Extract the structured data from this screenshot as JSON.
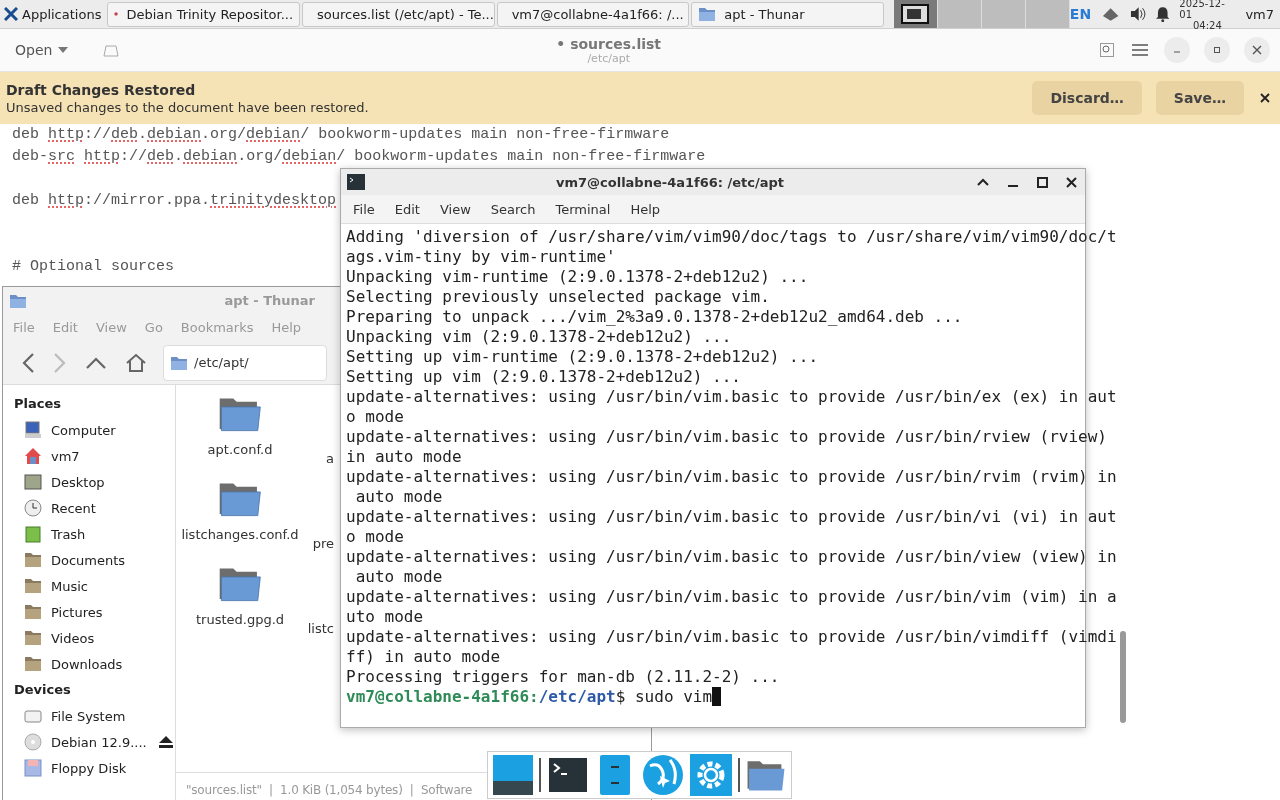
{
  "panel": {
    "apps_menu": "Applications",
    "tasks": [
      {
        "label": "Debian Trinity Repositor...",
        "kind": "browser"
      },
      {
        "label": "sources.list (/etc/apt) - Te...",
        "kind": "editor"
      },
      {
        "label": "vm7@collabne-4a1f66: /...",
        "kind": "terminal"
      },
      {
        "label": "apt - Thunar",
        "kind": "folder"
      }
    ],
    "workspaces": [
      {
        "selected": true
      },
      {
        "selected": false
      },
      {
        "selected": false
      },
      {
        "selected": false
      }
    ],
    "tray": {
      "language": "EN",
      "date": "2025-12-01",
      "time": "04:24",
      "user": "vm7"
    }
  },
  "editor": {
    "open_button": "Open",
    "title": "• sources.list",
    "subtitle": "/etc/apt",
    "infobar": {
      "title": "Draft Changes Restored",
      "message": "Unsaved changes to the document have been restored.",
      "buttons": [
        "Discard…",
        "Save…"
      ]
    },
    "lines": [
      {
        "kind": "code",
        "segments": [
          {
            "text": "deb ",
            "misspelled": false
          },
          {
            "text": "http",
            "misspelled": true
          },
          {
            "text": "://",
            "misspelled": false
          },
          {
            "text": "deb",
            "misspelled": true
          },
          {
            "text": ".",
            "misspelled": false
          },
          {
            "text": "debian",
            "misspelled": true
          },
          {
            "text": ".org/",
            "misspelled": false
          },
          {
            "text": "debian",
            "misspelled": true
          },
          {
            "text": "/ bookworm-updates main non-free-firmware",
            "misspelled": false
          }
        ]
      },
      {
        "kind": "code",
        "segments": [
          {
            "text": "deb-",
            "misspelled": false
          },
          {
            "text": "src",
            "misspelled": true
          },
          {
            "text": " http",
            "misspelled": true
          },
          {
            "text": "://",
            "misspelled": false
          },
          {
            "text": "deb",
            "misspelled": true
          },
          {
            "text": ".",
            "misspelled": false
          },
          {
            "text": "debian",
            "misspelled": true
          },
          {
            "text": ".org/",
            "misspelled": false
          },
          {
            "text": "debian",
            "misspelled": true
          },
          {
            "text": "/ bookworm-updates main non-free-firmware",
            "misspelled": false
          }
        ]
      },
      {
        "kind": "blank"
      },
      {
        "kind": "code",
        "segments": [
          {
            "text": "deb ",
            "misspelled": false
          },
          {
            "text": "http",
            "misspelled": true
          },
          {
            "text": "://mirror.ppa.",
            "misspelled": false
          },
          {
            "text": "trinitydesktop",
            "misspelled": true
          }
        ]
      },
      {
        "kind": "blank"
      },
      {
        "kind": "blank"
      },
      {
        "kind": "code",
        "segments": [
          {
            "text": "# Optional sources",
            "misspelled": false
          }
        ]
      }
    ]
  },
  "thunar": {
    "title": "apt - Thunar",
    "menu": [
      "File",
      "Edit",
      "View",
      "Go",
      "Bookmarks",
      "Help"
    ],
    "location": "/etc/apt/",
    "sections": [
      {
        "title": "Places",
        "items": [
          {
            "label": "Computer",
            "kind": "computer"
          },
          {
            "label": "vm7",
            "kind": "home"
          },
          {
            "label": "Desktop",
            "kind": "desktop"
          },
          {
            "label": "Recent",
            "kind": "recent"
          },
          {
            "label": "Trash",
            "kind": "trash"
          },
          {
            "label": "Documents",
            "kind": "folder"
          },
          {
            "label": "Music",
            "kind": "folder"
          },
          {
            "label": "Pictures",
            "kind": "folder"
          },
          {
            "label": "Videos",
            "kind": "folder"
          },
          {
            "label": "Downloads",
            "kind": "folder"
          }
        ]
      },
      {
        "title": "Devices",
        "items": [
          {
            "label": "File System",
            "kind": "drive"
          },
          {
            "label": "Debian 12.9....",
            "kind": "disc"
          },
          {
            "label": "Floppy Disk",
            "kind": "floppy"
          }
        ]
      }
    ],
    "folders": [
      {
        "label": "apt.conf.d",
        "column_2": "a"
      },
      {
        "label": "listchanges.conf.d",
        "column_2": "pre"
      },
      {
        "label": "trusted.gpg.d",
        "column_2": "listc"
      }
    ],
    "status": "\"sources.list\"  |  1.0 KiB (1,054 bytes)  |  Software"
  },
  "terminal": {
    "title": "vm7@collabne-4a1f66: /etc/apt",
    "menu": [
      "File",
      "Edit",
      "View",
      "Search",
      "Terminal",
      "Help"
    ],
    "rows": [
      "Adding 'diversion of /usr/share/vim/vim90/doc/tags to /usr/share/vim/vim90/doc/t",
      "ags.vim-tiny by vim-runtime'",
      "Unpacking vim-runtime (2:9.0.1378-2+deb12u2) ...",
      "Selecting previously unselected package vim.",
      "Preparing to unpack .../vim_2%3a9.0.1378-2+deb12u2_amd64.deb ...",
      "Unpacking vim (2:9.0.1378-2+deb12u2) ...",
      "Setting up vim-runtime (2:9.0.1378-2+deb12u2) ...",
      "Setting up vim (2:9.0.1378-2+deb12u2) ...",
      "update-alternatives: using /usr/bin/vim.basic to provide /usr/bin/ex (ex) in aut",
      "o mode",
      "update-alternatives: using /usr/bin/vim.basic to provide /usr/bin/rview (rview)",
      "in auto mode",
      "update-alternatives: using /usr/bin/vim.basic to provide /usr/bin/rvim (rvim) in",
      " auto mode",
      "update-alternatives: using /usr/bin/vim.basic to provide /usr/bin/vi (vi) in aut",
      "o mode",
      "update-alternatives: using /usr/bin/vim.basic to provide /usr/bin/view (view) in",
      " auto mode",
      "update-alternatives: using /usr/bin/vim.basic to provide /usr/bin/vim (vim) in a",
      "uto mode",
      "update-alternatives: using /usr/bin/vim.basic to provide /usr/bin/vimdiff (vimdi",
      "ff) in auto mode",
      "Processing triggers for man-db (2.11.2-2) ..."
    ],
    "prompt": {
      "user_host": "vm7@collabne-4a1f66:",
      "path": "/etc/apt",
      "command": "$ sudo vim"
    }
  },
  "dock": [
    {
      "kind": "show-desktop"
    },
    {
      "kind": "separator"
    },
    {
      "kind": "terminal"
    },
    {
      "kind": "files"
    },
    {
      "kind": "globe"
    },
    {
      "kind": "settings"
    },
    {
      "kind": "separator"
    },
    {
      "kind": "folder"
    }
  ]
}
